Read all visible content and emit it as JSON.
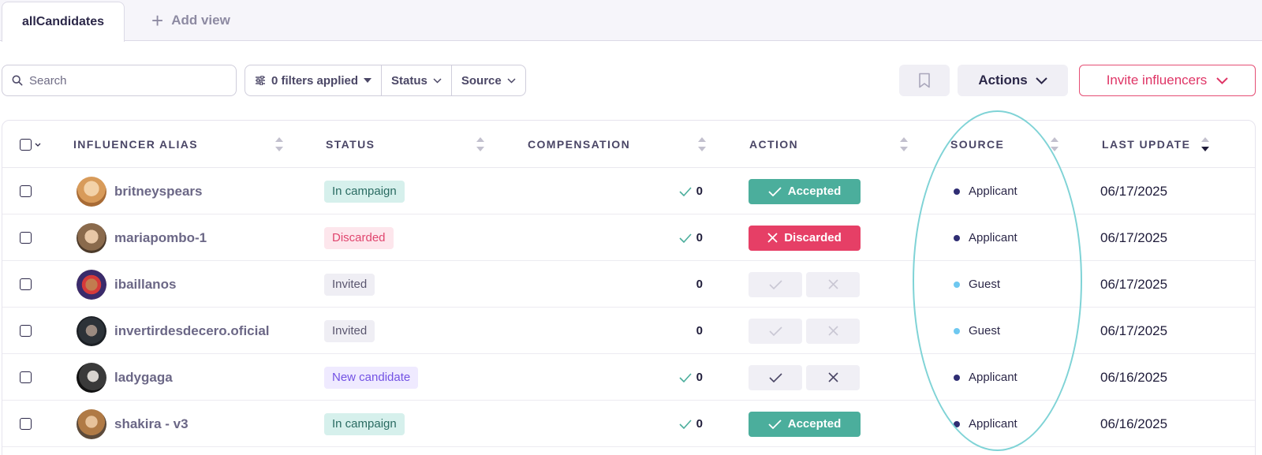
{
  "tabs": {
    "active": "allCandidates",
    "add_view": "Add view"
  },
  "toolbar": {
    "search_placeholder": "Search",
    "filters_applied": "0 filters applied",
    "status_filter": "Status",
    "source_filter": "Source",
    "actions_label": "Actions",
    "invite_label": "Invite influencers"
  },
  "table": {
    "headers": {
      "alias": "INFLUENCER ALIAS",
      "status": "STATUS",
      "compensation": "COMPENSATION",
      "action": "ACTION",
      "source": "SOURCE",
      "last_update": "LAST UPDATE"
    },
    "rows": [
      {
        "alias": "britneyspears",
        "status": "In campaign",
        "compensation": "0",
        "action": "Accepted",
        "source": "Applicant",
        "date": "06/17/2025"
      },
      {
        "alias": "mariapombo-1",
        "status": "Discarded",
        "compensation": "0",
        "action": "Discarded",
        "source": "Applicant",
        "date": "06/17/2025"
      },
      {
        "alias": "ibaillanos",
        "status": "Invited",
        "compensation": "0",
        "action": "",
        "source": "Guest",
        "date": "06/17/2025"
      },
      {
        "alias": "invertirdesdecero.oficial",
        "status": "Invited",
        "compensation": "0",
        "action": "",
        "source": "Guest",
        "date": "06/17/2025"
      },
      {
        "alias": "ladygaga",
        "status": "New candidate",
        "compensation": "0",
        "action": "",
        "source": "Applicant",
        "date": "06/16/2025"
      },
      {
        "alias": "shakira - v3",
        "status": "In campaign",
        "compensation": "0",
        "action": "Accepted",
        "source": "Applicant",
        "date": "06/16/2025"
      }
    ]
  },
  "colors": {
    "accent_pink": "#e54e74",
    "accepted_green": "#4bae9c",
    "discarded_red": "#e63f66",
    "applicant_dot": "#2f2d73",
    "guest_dot": "#6ec8f0",
    "highlight_ellipse": "#7fd3d6"
  }
}
